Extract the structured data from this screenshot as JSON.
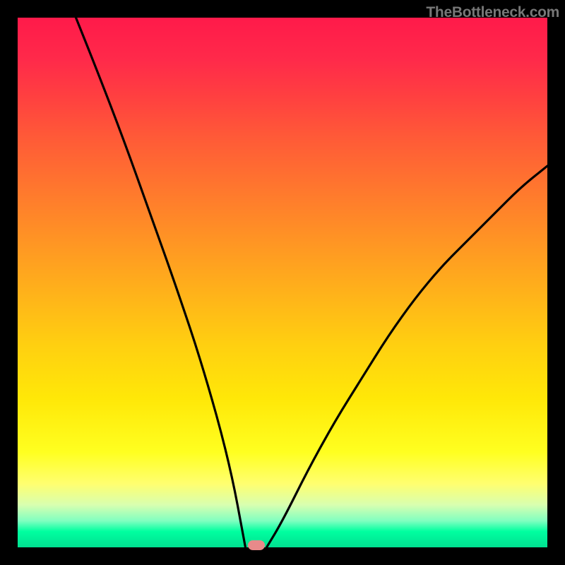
{
  "watermark": "TheBottleneck.com",
  "chart_data": {
    "type": "line",
    "title": "",
    "xlabel": "",
    "ylabel": "",
    "xlim": [
      0,
      100
    ],
    "ylim": [
      0,
      100
    ],
    "background_gradient": {
      "top": "#ff1a4a",
      "bottom": "#00e090",
      "description": "vertical rainbow gradient red→orange→yellow→green representing bottleneck severity (red high, green low)"
    },
    "series": [
      {
        "name": "bottleneck-curve",
        "description": "V-shaped curve showing bottleneck percentage. Left branch descends steeply from ~100 at x≈11 to 0 at x≈43; right branch rises from 0 at x≈47 following a concave curve to ~72 at x=100.",
        "x": [
          11,
          15,
          20,
          25,
          30,
          35,
          40,
          43,
          47,
          50,
          55,
          60,
          65,
          70,
          75,
          80,
          85,
          90,
          95,
          100
        ],
        "values": [
          100,
          90,
          77,
          63,
          49,
          34,
          16,
          0,
          0,
          5,
          15,
          24,
          32,
          40,
          47,
          53,
          58,
          63,
          68,
          72
        ]
      }
    ],
    "marker": {
      "description": "optimal (zero-bottleneck) point",
      "x": 45,
      "y": 0,
      "color": "#e88a8a"
    }
  }
}
